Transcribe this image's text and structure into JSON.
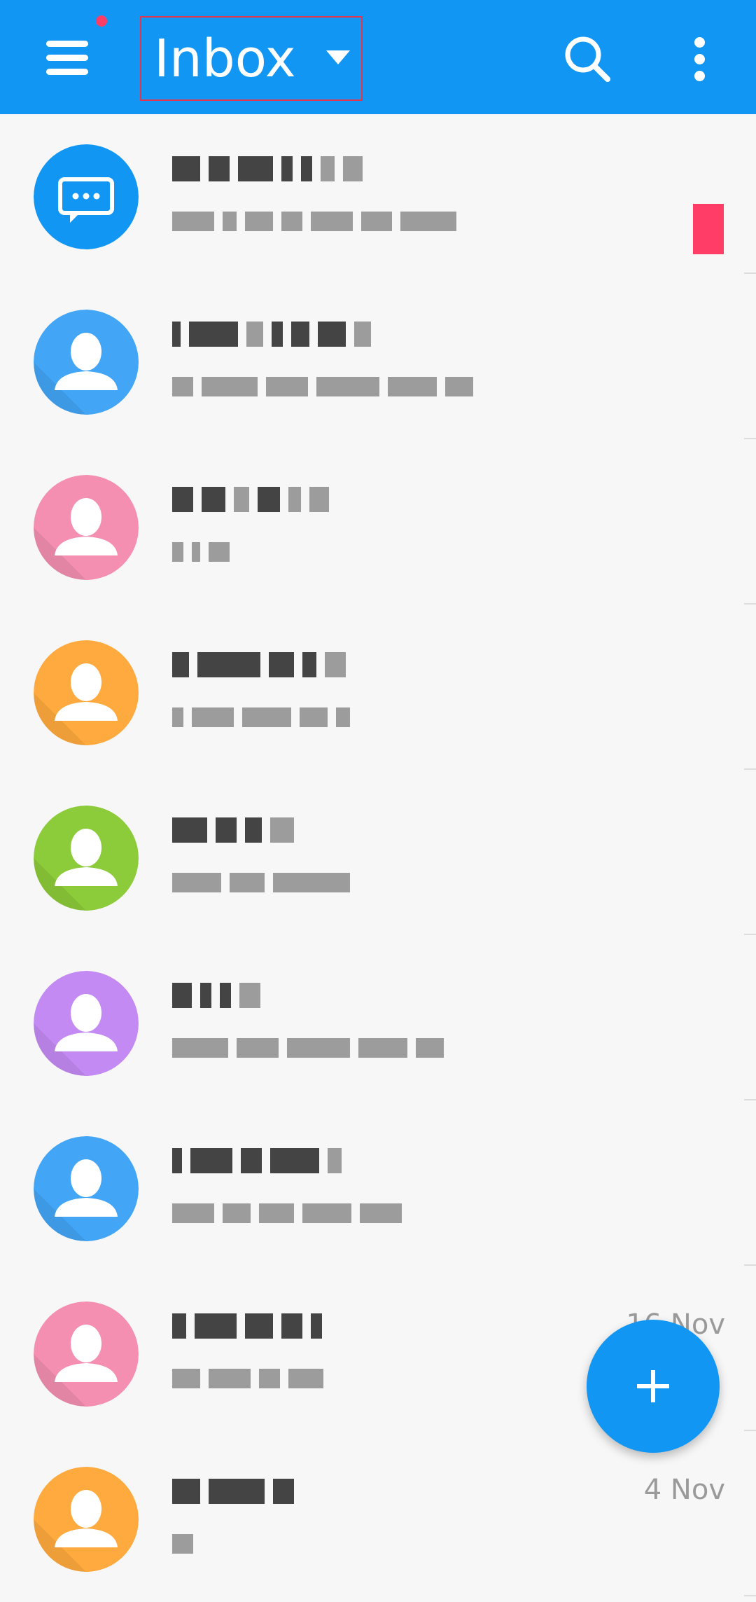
{
  "header": {
    "title": "Inbox"
  },
  "colors": {
    "app_bar": "#1296f3",
    "notification_dot": "#ff3d67",
    "highlight_box": "#e3364d"
  },
  "messages": [
    {
      "avatar": "chat",
      "color": "#1296f3",
      "sender": "",
      "snippet": "",
      "date": "",
      "flagged": true
    },
    {
      "avatar": "person",
      "color": "#42a5f5",
      "sender": "",
      "snippet": "",
      "date": ""
    },
    {
      "avatar": "person",
      "color": "#f48fb1",
      "sender": "",
      "snippet": "",
      "date": ""
    },
    {
      "avatar": "person",
      "color": "#ffaa3e",
      "sender": "",
      "snippet": "",
      "date": ""
    },
    {
      "avatar": "person",
      "color": "#8ccb3a",
      "sender": "",
      "snippet": "",
      "date": ""
    },
    {
      "avatar": "person",
      "color": "#c38af3",
      "sender": "",
      "snippet": "",
      "date": ""
    },
    {
      "avatar": "person",
      "color": "#42a5f5",
      "sender": "",
      "snippet": "",
      "date": ""
    },
    {
      "avatar": "person",
      "color": "#f48fb1",
      "sender": "",
      "snippet": "",
      "date": "16 Nov"
    },
    {
      "avatar": "person",
      "color": "#ffaa3e",
      "sender": "",
      "snippet": "",
      "date": "4 Nov"
    }
  ],
  "icons": {
    "menu": "menu-icon",
    "search": "search-icon",
    "overflow": "more-vert-icon",
    "compose": "plus-icon"
  }
}
